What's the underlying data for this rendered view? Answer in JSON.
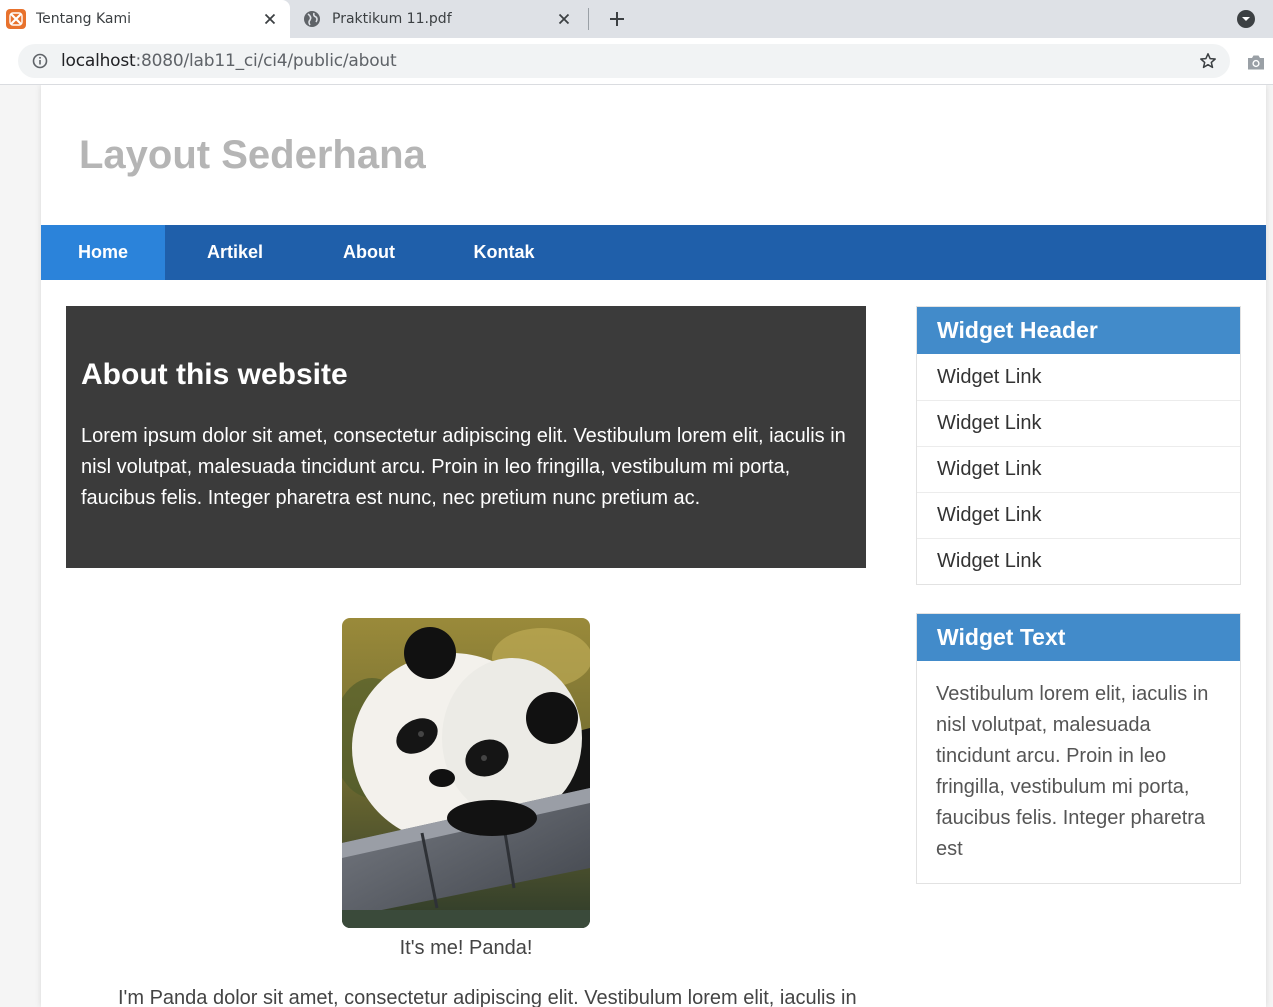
{
  "browser": {
    "tabs": [
      {
        "title": "Tentang Kami",
        "icon": "xampp-icon",
        "active": true
      },
      {
        "title": "Praktikum 11.pdf",
        "icon": "globe-icon",
        "active": false
      }
    ],
    "url_host": "localhost",
    "url_rest": ":8080/lab11_ci/ci4/public/about",
    "accent_color": "#e8722d"
  },
  "site": {
    "title": "Layout Sederhana"
  },
  "nav": {
    "items": [
      {
        "label": "Home",
        "active": true
      },
      {
        "label": "Artikel",
        "active": false
      },
      {
        "label": "About",
        "active": false
      },
      {
        "label": "Kontak",
        "active": false
      }
    ],
    "bar_color": "#1f5faa",
    "active_color": "#2b83da"
  },
  "hero": {
    "heading": "About this website",
    "body": "Lorem ipsum dolor sit amet, consectetur adipiscing elit. Vestibulum lorem elit, iaculis in nisl volutpat, malesuada tincidunt arcu. Proin in leo fringilla, vestibulum mi porta, faucibus felis. Integer pharetra est nunc, nec pretium nunc pretium ac."
  },
  "content": {
    "image_alt": "panda-photo",
    "caption": "It's me! Panda!",
    "intro": "I'm Panda dolor sit amet, consectetur adipiscing elit. Vestibulum lorem elit, iaculis in"
  },
  "sidebar": {
    "links_widget": {
      "header": "Widget Header",
      "links": [
        "Widget Link",
        "Widget Link",
        "Widget Link",
        "Widget Link",
        "Widget Link"
      ]
    },
    "text_widget": {
      "header": "Widget Text",
      "body": "Vestibulum lorem elit, iaculis in nisl volutpat, malesuada tincidunt arcu. Proin in leo fringilla, vestibulum mi porta, faucibus felis. Integer pharetra est"
    },
    "header_color": "#428bca"
  }
}
